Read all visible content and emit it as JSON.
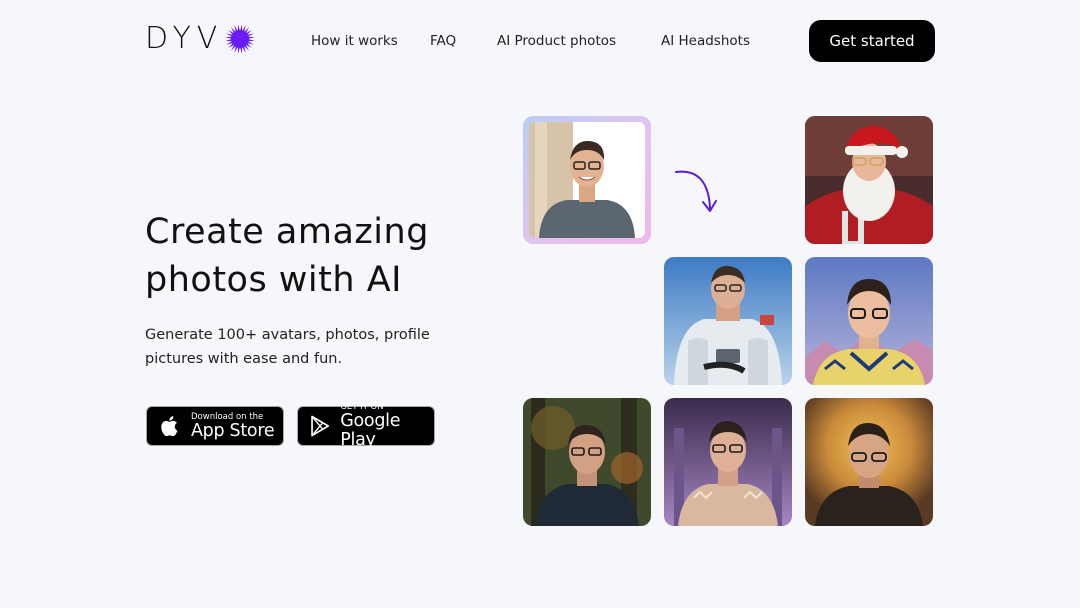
{
  "header": {
    "logo_text": "DYV",
    "logo_mark_icon": "purple-starburst-icon",
    "nav": [
      "How it works",
      "FAQ",
      "AI Product photos",
      "AI Headshots"
    ],
    "cta_label": "Get started"
  },
  "hero": {
    "headline": "Create amazing photos with AI",
    "subtitle": "Generate 100+ avatars, photos, profile pictures with ease and fun."
  },
  "badges": {
    "app_store": {
      "small": "Download on the",
      "big": "App Store",
      "icon": "apple-icon"
    },
    "google_play": {
      "small": "GET IT ON",
      "big": "Google Play",
      "icon": "google-play-icon"
    }
  },
  "gallery": {
    "source_photo": "source-selfie",
    "arrow_icon": "curved-arrow-down-icon",
    "results": [
      "santa-avatar",
      "astronaut-avatar",
      "royal-avatar",
      "forest-avatar",
      "palace-avatar",
      "halo-avatar"
    ]
  },
  "colors": {
    "background": "#f6f7fb",
    "brand_accent": "#6a1cf5",
    "button": "#000000"
  }
}
